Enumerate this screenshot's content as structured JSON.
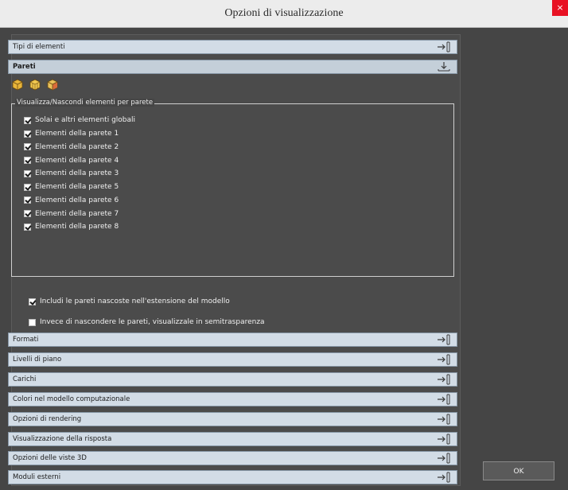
{
  "window": {
    "title": "Opzioni di visualizzazione",
    "close_glyph": "×"
  },
  "sections_top": [
    {
      "label": "Tipi di elementi",
      "state": "collapsed"
    },
    {
      "label": "Pareti",
      "state": "expanded"
    }
  ],
  "toolbar": {
    "icons": [
      "cube-yellow-icon",
      "cube-yellow-icon",
      "cube-multi-icon"
    ]
  },
  "group": {
    "title": "Visualizza/Nascondi elementi per parete",
    "items": [
      {
        "label": "Solai e altri elementi globali",
        "checked": true
      },
      {
        "label": "Elementi della parete 1",
        "checked": true
      },
      {
        "label": "Elementi della parete 2",
        "checked": true
      },
      {
        "label": "Elementi della parete 4",
        "checked": true
      },
      {
        "label": "Elementi della parete 3",
        "checked": true
      },
      {
        "label": "Elementi della parete 5",
        "checked": true
      },
      {
        "label": "Elementi della parete 6",
        "checked": true
      },
      {
        "label": "Elementi della parete 7",
        "checked": true
      },
      {
        "label": "Elementi della parete 8",
        "checked": true
      }
    ]
  },
  "options": [
    {
      "label": "Includi le pareti nascoste nell'estensione del modello",
      "checked": true
    },
    {
      "label": "Invece di nascondere le pareti, visualizzale in semitrasparenza",
      "checked": false
    }
  ],
  "sections_bottom": [
    {
      "label": "Formati"
    },
    {
      "label": "Livelli di piano"
    },
    {
      "label": "Carichi"
    },
    {
      "label": "Colori nel modello computazionale"
    },
    {
      "label": "Opzioni di rendering"
    },
    {
      "label": "Visualizzazione della risposta"
    },
    {
      "label": "Opzioni delle viste 3D"
    },
    {
      "label": "Moduli esterni"
    }
  ],
  "buttons": {
    "ok": "OK"
  },
  "colors": {
    "header": "#d2dce6",
    "background": "#454545",
    "close": "#e81123"
  }
}
